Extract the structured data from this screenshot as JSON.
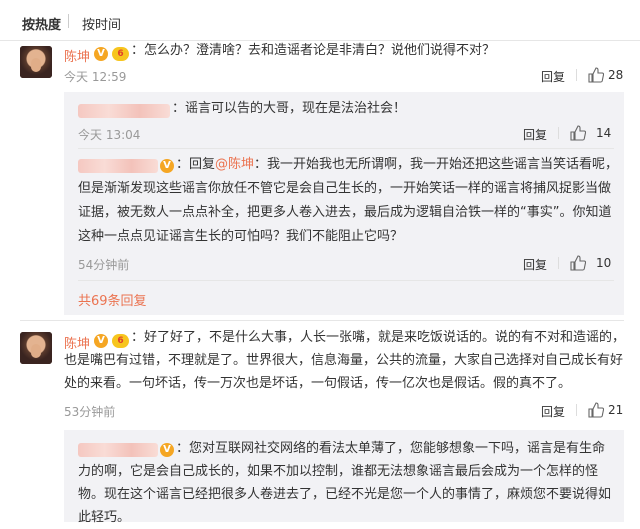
{
  "sort": {
    "by_heat": "按热度",
    "by_time": "按时间"
  },
  "comments": [
    {
      "author": "陈坤",
      "verified": "V",
      "vip": "6",
      "text": "：怎么办？澄清啥？去和造谣者论是非清白？说他们说得不对？",
      "time": "今天 12:59",
      "reply_label": "回复",
      "likes": "28",
      "replies": [
        {
          "text": "：谣言可以告的大哥，现在是法治社会！",
          "time": "今天 13:04",
          "reply_label": "回复",
          "likes": "14"
        },
        {
          "verified": "V",
          "reply_prefix": "：回复",
          "mention": "@陈坤",
          "line1": "：我一开始我也无所谓啊，我一开始还把这些谣言当笑话看呢，",
          "line2": "但是渐渐发现这些谣言你放任不管它是会自己生长的，一开始笑话一样的谣言将捕风捉影当做",
          "line3": "证据，被无数人一点点补全，把更多人卷入进去，最后成为逻辑自洽铁一样的“事实”。你知道",
          "line4": "这种一点点见证谣言生长的可怕吗？我们不能阻止它吗？",
          "time": "54分钟前",
          "reply_label": "回复",
          "likes": "10"
        }
      ],
      "more_replies": "共69条回复"
    },
    {
      "author": "陈坤",
      "verified": "V",
      "vip": "6",
      "line1": "：好了好了，不是什么大事，人长一张嘴，就是来吃饭说话的。说的有不对和造谣的，",
      "line2": "也是嘴巴有过错，不理就是了。世界很大，信息海量，公共的流量，大家自己选择对自己成长有好",
      "line3": "处的来看。一句坏话，传一万次也是坏话，一句假话，传一亿次也是假话。假的真不了。",
      "time": "53分钟前",
      "reply_label": "回复",
      "likes": "21",
      "replies": [
        {
          "verified": "V",
          "line1": "：您对互联网社交网络的看法太单薄了，您能够想象一下吗，谣言是有生命",
          "line2": "力的啊，它是会自己成长的，如果不加以控制，谁都无法想象谣言最后会成为一个怎样的怪",
          "line3": "物。现在这个谣言已经把很多人卷进去了，已经不光是您一个人的事情了，麻烦您不要说得如",
          "line4": "此轻巧。"
        }
      ]
    }
  ],
  "icons": {
    "like": "thumbs-up-icon"
  }
}
